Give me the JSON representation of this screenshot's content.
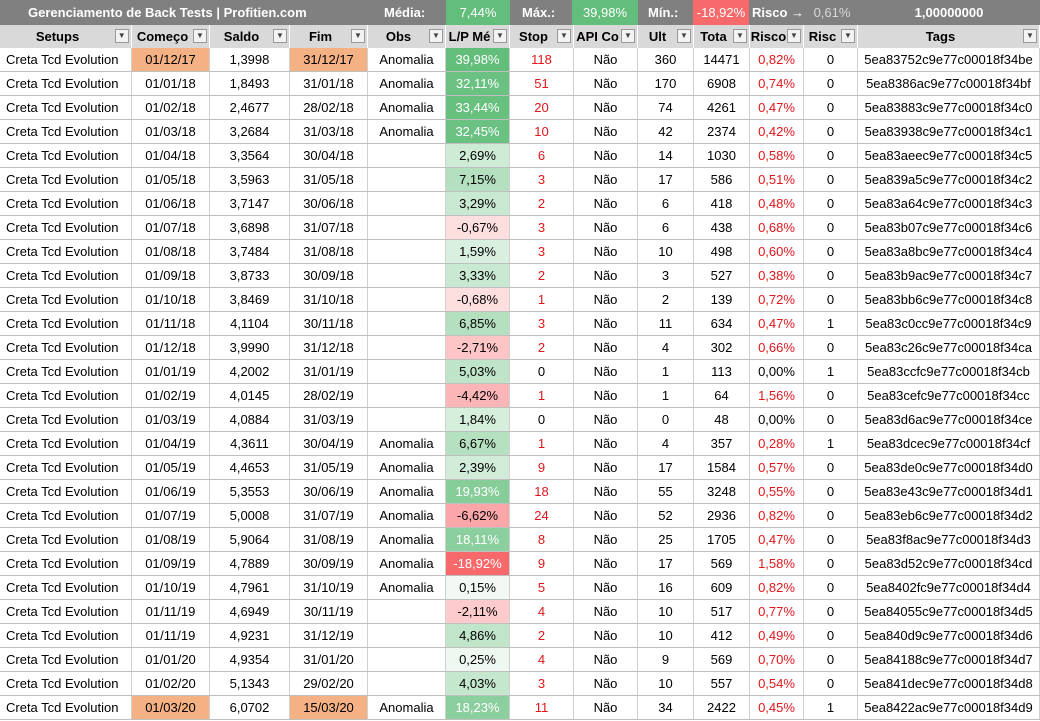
{
  "topbar": {
    "title": "Gerenciamento de Back Tests | Profitien.com",
    "media_label": "Média:",
    "media_value": "7,44%",
    "max_label": "Máx.:",
    "max_value": "39,98%",
    "min_label": "Mín.:",
    "min_value": "-18,92%",
    "risco_label": "Risco",
    "risco_value": "0,61%",
    "total_value": "1,00000000"
  },
  "colors": {
    "topbar_bg": "#808080",
    "header_bg": "#d9d9d9",
    "date_highlight": "#f4b183",
    "negative_text": "#e0161b",
    "scale_high": "#63be7b",
    "scale_low": "#f8696b"
  },
  "columns": [
    {
      "key": "setup",
      "label": "Setups",
      "filter": "filtered"
    },
    {
      "key": "start",
      "label": "Começo",
      "filter": "sorted"
    },
    {
      "key": "saldo",
      "label": "Saldo",
      "filter": "dropdown"
    },
    {
      "key": "end",
      "label": "Fim",
      "filter": "dropdown"
    },
    {
      "key": "obs",
      "label": "Obs",
      "filter": "dropdown"
    },
    {
      "key": "lp",
      "label": "L/P Mé",
      "filter": "dropdown"
    },
    {
      "key": "stop",
      "label": "Stop",
      "filter": "dropdown"
    },
    {
      "key": "api",
      "label": "API Co",
      "filter": "dropdown"
    },
    {
      "key": "ult",
      "label": "Ult",
      "filter": "dropdown"
    },
    {
      "key": "total",
      "label": "Tota",
      "filter": "dropdown"
    },
    {
      "key": "risco",
      "label": "Risco",
      "filter": "dropdown"
    },
    {
      "key": "risco2",
      "label": "Risc",
      "filter": "dropdown"
    },
    {
      "key": "tags",
      "label": "Tags",
      "filter": "dropdown"
    }
  ],
  "rows": [
    {
      "setup": "Creta Tcd Evolution",
      "start": "01/12/17",
      "saldo": "1,3998",
      "end": "31/12/17",
      "obs": "Anomalia",
      "lp": "39,98%",
      "lp_val": 39.98,
      "stop": "118",
      "api": "Não",
      "ult": "360",
      "total": "14471",
      "risco": "0,82%",
      "risco2": "0",
      "tags": "5ea83752c9e77c00018f34be",
      "hl": true
    },
    {
      "setup": "Creta Tcd Evolution",
      "start": "01/01/18",
      "saldo": "1,8493",
      "end": "31/01/18",
      "obs": "Anomalia",
      "lp": "32,11%",
      "lp_val": 32.11,
      "stop": "51",
      "api": "Não",
      "ult": "170",
      "total": "6908",
      "risco": "0,74%",
      "risco2": "0",
      "tags": "5ea8386ac9e77c00018f34bf",
      "hl": false
    },
    {
      "setup": "Creta Tcd Evolution",
      "start": "01/02/18",
      "saldo": "2,4677",
      "end": "28/02/18",
      "obs": "Anomalia",
      "lp": "33,44%",
      "lp_val": 33.44,
      "stop": "20",
      "api": "Não",
      "ult": "74",
      "total": "4261",
      "risco": "0,47%",
      "risco2": "0",
      "tags": "5ea83883c9e77c00018f34c0",
      "hl": false
    },
    {
      "setup": "Creta Tcd Evolution",
      "start": "01/03/18",
      "saldo": "3,2684",
      "end": "31/03/18",
      "obs": "Anomalia",
      "lp": "32,45%",
      "lp_val": 32.45,
      "stop": "10",
      "api": "Não",
      "ult": "42",
      "total": "2374",
      "risco": "0,42%",
      "risco2": "0",
      "tags": "5ea83938c9e77c00018f34c1",
      "hl": false
    },
    {
      "setup": "Creta Tcd Evolution",
      "start": "01/04/18",
      "saldo": "3,3564",
      "end": "30/04/18",
      "obs": "",
      "lp": "2,69%",
      "lp_val": 2.69,
      "stop": "6",
      "api": "Não",
      "ult": "14",
      "total": "1030",
      "risco": "0,58%",
      "risco2": "0",
      "tags": "5ea83aeec9e77c00018f34c5",
      "hl": false
    },
    {
      "setup": "Creta Tcd Evolution",
      "start": "01/05/18",
      "saldo": "3,5963",
      "end": "31/05/18",
      "obs": "",
      "lp": "7,15%",
      "lp_val": 7.15,
      "stop": "3",
      "api": "Não",
      "ult": "17",
      "total": "586",
      "risco": "0,51%",
      "risco2": "0",
      "tags": "5ea839a5c9e77c00018f34c2",
      "hl": false
    },
    {
      "setup": "Creta Tcd Evolution",
      "start": "01/06/18",
      "saldo": "3,7147",
      "end": "30/06/18",
      "obs": "",
      "lp": "3,29%",
      "lp_val": 3.29,
      "stop": "2",
      "api": "Não",
      "ult": "6",
      "total": "418",
      "risco": "0,48%",
      "risco2": "0",
      "tags": "5ea83a64c9e77c00018f34c3",
      "hl": false
    },
    {
      "setup": "Creta Tcd Evolution",
      "start": "01/07/18",
      "saldo": "3,6898",
      "end": "31/07/18",
      "obs": "",
      "lp": "-0,67%",
      "lp_val": -0.67,
      "stop": "3",
      "api": "Não",
      "ult": "6",
      "total": "438",
      "risco": "0,68%",
      "risco2": "0",
      "tags": "5ea83b07c9e77c00018f34c6",
      "hl": false
    },
    {
      "setup": "Creta Tcd Evolution",
      "start": "01/08/18",
      "saldo": "3,7484",
      "end": "31/08/18",
      "obs": "",
      "lp": "1,59%",
      "lp_val": 1.59,
      "stop": "3",
      "api": "Não",
      "ult": "10",
      "total": "498",
      "risco": "0,60%",
      "risco2": "0",
      "tags": "5ea83a8bc9e77c00018f34c4",
      "hl": false
    },
    {
      "setup": "Creta Tcd Evolution",
      "start": "01/09/18",
      "saldo": "3,8733",
      "end": "30/09/18",
      "obs": "",
      "lp": "3,33%",
      "lp_val": 3.33,
      "stop": "2",
      "api": "Não",
      "ult": "3",
      "total": "527",
      "risco": "0,38%",
      "risco2": "0",
      "tags": "5ea83b9ac9e77c00018f34c7",
      "hl": false
    },
    {
      "setup": "Creta Tcd Evolution",
      "start": "01/10/18",
      "saldo": "3,8469",
      "end": "31/10/18",
      "obs": "",
      "lp": "-0,68%",
      "lp_val": -0.68,
      "stop": "1",
      "api": "Não",
      "ult": "2",
      "total": "139",
      "risco": "0,72%",
      "risco2": "0",
      "tags": "5ea83bb6c9e77c00018f34c8",
      "hl": false
    },
    {
      "setup": "Creta Tcd Evolution",
      "start": "01/11/18",
      "saldo": "4,1104",
      "end": "30/11/18",
      "obs": "",
      "lp": "6,85%",
      "lp_val": 6.85,
      "stop": "3",
      "api": "Não",
      "ult": "11",
      "total": "634",
      "risco": "0,47%",
      "risco2": "1",
      "tags": "5ea83c0cc9e77c00018f34c9",
      "hl": false
    },
    {
      "setup": "Creta Tcd Evolution",
      "start": "01/12/18",
      "saldo": "3,9990",
      "end": "31/12/18",
      "obs": "",
      "lp": "-2,71%",
      "lp_val": -2.71,
      "stop": "2",
      "api": "Não",
      "ult": "4",
      "total": "302",
      "risco": "0,66%",
      "risco2": "0",
      "tags": "5ea83c26c9e77c00018f34ca",
      "hl": false
    },
    {
      "setup": "Creta Tcd Evolution",
      "start": "01/01/19",
      "saldo": "4,2002",
      "end": "31/01/19",
      "obs": "",
      "lp": "5,03%",
      "lp_val": 5.03,
      "stop": "0",
      "api": "Não",
      "ult": "1",
      "total": "113",
      "risco": "0,00%",
      "risco2": "1",
      "tags": "5ea83ccfc9e77c00018f34cb",
      "hl": false
    },
    {
      "setup": "Creta Tcd Evolution",
      "start": "01/02/19",
      "saldo": "4,0145",
      "end": "28/02/19",
      "obs": "",
      "lp": "-4,42%",
      "lp_val": -4.42,
      "stop": "1",
      "api": "Não",
      "ult": "1",
      "total": "64",
      "risco": "1,56%",
      "risco2": "0",
      "tags": "5ea83cefc9e77c00018f34cc",
      "hl": false
    },
    {
      "setup": "Creta Tcd Evolution",
      "start": "01/03/19",
      "saldo": "4,0884",
      "end": "31/03/19",
      "obs": "",
      "lp": "1,84%",
      "lp_val": 1.84,
      "stop": "0",
      "api": "Não",
      "ult": "0",
      "total": "48",
      "risco": "0,00%",
      "risco2": "0",
      "tags": "5ea83d6ac9e77c00018f34ce",
      "hl": false
    },
    {
      "setup": "Creta Tcd Evolution",
      "start": "01/04/19",
      "saldo": "4,3611",
      "end": "30/04/19",
      "obs": "Anomalia",
      "lp": "6,67%",
      "lp_val": 6.67,
      "stop": "1",
      "api": "Não",
      "ult": "4",
      "total": "357",
      "risco": "0,28%",
      "risco2": "1",
      "tags": "5ea83dcec9e77c00018f34cf",
      "hl": false
    },
    {
      "setup": "Creta Tcd Evolution",
      "start": "01/05/19",
      "saldo": "4,4653",
      "end": "31/05/19",
      "obs": "Anomalia",
      "lp": "2,39%",
      "lp_val": 2.39,
      "stop": "9",
      "api": "Não",
      "ult": "17",
      "total": "1584",
      "risco": "0,57%",
      "risco2": "0",
      "tags": "5ea83de0c9e77c00018f34d0",
      "hl": false
    },
    {
      "setup": "Creta Tcd Evolution",
      "start": "01/06/19",
      "saldo": "5,3553",
      "end": "30/06/19",
      "obs": "Anomalia",
      "lp": "19,93%",
      "lp_val": 19.93,
      "stop": "18",
      "api": "Não",
      "ult": "55",
      "total": "3248",
      "risco": "0,55%",
      "risco2": "0",
      "tags": "5ea83e43c9e77c00018f34d1",
      "hl": false
    },
    {
      "setup": "Creta Tcd Evolution",
      "start": "01/07/19",
      "saldo": "5,0008",
      "end": "31/07/19",
      "obs": "Anomalia",
      "lp": "-6,62%",
      "lp_val": -6.62,
      "stop": "24",
      "api": "Não",
      "ult": "52",
      "total": "2936",
      "risco": "0,82%",
      "risco2": "0",
      "tags": "5ea83eb6c9e77c00018f34d2",
      "hl": false
    },
    {
      "setup": "Creta Tcd Evolution",
      "start": "01/08/19",
      "saldo": "5,9064",
      "end": "31/08/19",
      "obs": "Anomalia",
      "lp": "18,11%",
      "lp_val": 18.11,
      "stop": "8",
      "api": "Não",
      "ult": "25",
      "total": "1705",
      "risco": "0,47%",
      "risco2": "0",
      "tags": "5ea83f8ac9e77c00018f34d3",
      "hl": false
    },
    {
      "setup": "Creta Tcd Evolution",
      "start": "01/09/19",
      "saldo": "4,7889",
      "end": "30/09/19",
      "obs": "Anomalia",
      "lp": "-18,92%",
      "lp_val": -18.92,
      "stop": "9",
      "api": "Não",
      "ult": "17",
      "total": "569",
      "risco": "1,58%",
      "risco2": "0",
      "tags": "5ea83d52c9e77c00018f34cd",
      "hl": false
    },
    {
      "setup": "Creta Tcd Evolution",
      "start": "01/10/19",
      "saldo": "4,7961",
      "end": "31/10/19",
      "obs": "Anomalia",
      "lp": "0,15%",
      "lp_val": 0.15,
      "stop": "5",
      "api": "Não",
      "ult": "16",
      "total": "609",
      "risco": "0,82%",
      "risco2": "0",
      "tags": "5ea8402fc9e77c00018f34d4",
      "hl": false
    },
    {
      "setup": "Creta Tcd Evolution",
      "start": "01/11/19",
      "saldo": "4,6949",
      "end": "30/11/19",
      "obs": "",
      "lp": "-2,11%",
      "lp_val": -2.11,
      "stop": "4",
      "api": "Não",
      "ult": "10",
      "total": "517",
      "risco": "0,77%",
      "risco2": "0",
      "tags": "5ea84055c9e77c00018f34d5",
      "hl": false
    },
    {
      "setup": "Creta Tcd Evolution",
      "start": "01/11/19",
      "saldo": "4,9231",
      "end": "31/12/19",
      "obs": "",
      "lp": "4,86%",
      "lp_val": 4.86,
      "stop": "2",
      "api": "Não",
      "ult": "10",
      "total": "412",
      "risco": "0,49%",
      "risco2": "0",
      "tags": "5ea840d9c9e77c00018f34d6",
      "hl": false
    },
    {
      "setup": "Creta Tcd Evolution",
      "start": "01/01/20",
      "saldo": "4,9354",
      "end": "31/01/20",
      "obs": "",
      "lp": "0,25%",
      "lp_val": 0.25,
      "stop": "4",
      "api": "Não",
      "ult": "9",
      "total": "569",
      "risco": "0,70%",
      "risco2": "0",
      "tags": "5ea84188c9e77c00018f34d7",
      "hl": false
    },
    {
      "setup": "Creta Tcd Evolution",
      "start": "01/02/20",
      "saldo": "5,1343",
      "end": "29/02/20",
      "obs": "",
      "lp": "4,03%",
      "lp_val": 4.03,
      "stop": "3",
      "api": "Não",
      "ult": "10",
      "total": "557",
      "risco": "0,54%",
      "risco2": "0",
      "tags": "5ea841dec9e77c00018f34d8",
      "hl": false
    },
    {
      "setup": "Creta Tcd Evolution",
      "start": "01/03/20",
      "saldo": "6,0702",
      "end": "15/03/20",
      "obs": "Anomalia",
      "lp": "18,23%",
      "lp_val": 18.23,
      "stop": "11",
      "api": "Não",
      "ult": "34",
      "total": "2422",
      "risco": "0,45%",
      "risco2": "1",
      "tags": "5ea8422ac9e77c00018f34d9",
      "hl": true
    }
  ]
}
